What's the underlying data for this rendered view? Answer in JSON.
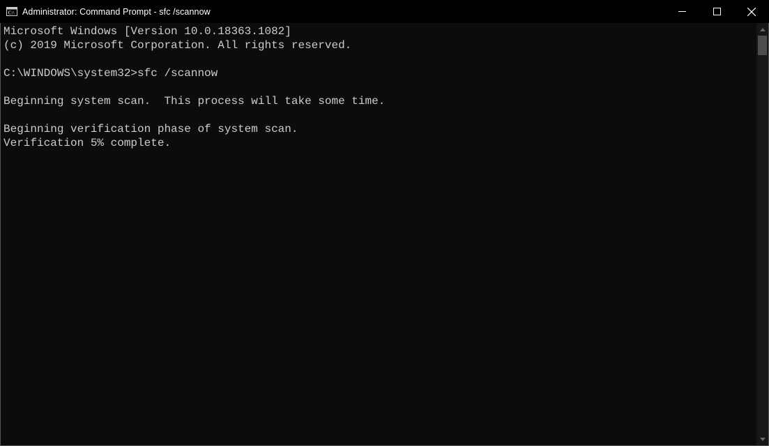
{
  "window": {
    "title": "Administrator: Command Prompt - sfc  /scannow"
  },
  "terminal": {
    "lines": [
      "Microsoft Windows [Version 10.0.18363.1082]",
      "(c) 2019 Microsoft Corporation. All rights reserved.",
      "",
      "C:\\WINDOWS\\system32>sfc /scannow",
      "",
      "Beginning system scan.  This process will take some time.",
      "",
      "Beginning verification phase of system scan.",
      "Verification 5% complete."
    ]
  }
}
